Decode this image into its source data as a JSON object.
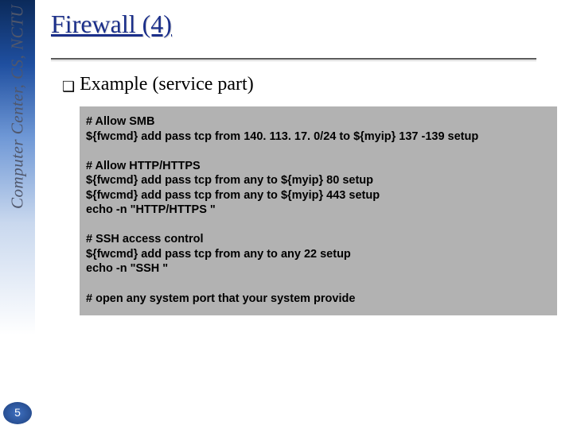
{
  "sidebar": {
    "org_text": "Computer Center, CS, NCTU",
    "page_number": "5"
  },
  "title": "Firewall (4)",
  "subtitle": "Example (service part)",
  "code": "# Allow SMB\n${fwcmd} add pass tcp from 140. 113. 17. 0/24 to ${myip} 137 -139 setup\n\n# Allow HTTP/HTTPS\n${fwcmd} add pass tcp from any to ${myip} 80 setup\n${fwcmd} add pass tcp from any to ${myip} 443 setup\necho -n \"HTTP/HTTPS \"\n\n# SSH access control\n${fwcmd} add pass tcp from any to any 22 setup\necho -n \"SSH \"\n\n# open any system port that your system provide"
}
